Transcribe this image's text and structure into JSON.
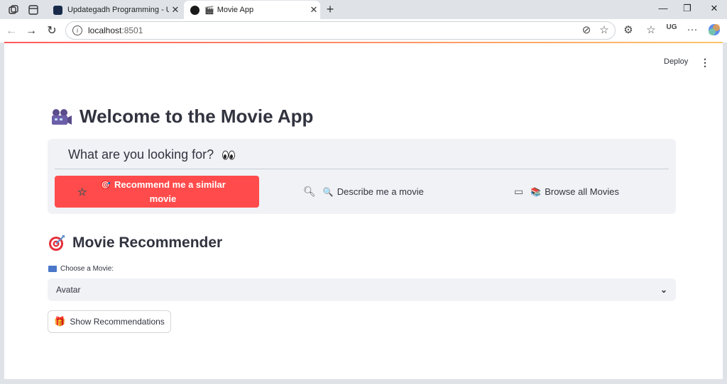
{
  "browser": {
    "tabs": [
      {
        "title": "Updategadh Programming - Upd",
        "active": false,
        "favicon_color": "#1a2b4a"
      },
      {
        "title": "Movie App",
        "active": true,
        "favicon_color": "#1a1a1a"
      }
    ],
    "url_host": "localhost",
    "url_port": ":8501",
    "accent_gradient": [
      "#ff5b5b",
      "#ffc46b"
    ],
    "icons": [
      "workspaces-icon",
      "tab-actions-icon",
      "close-icon",
      "new-tab-icon",
      "minimize-icon",
      "restore-icon",
      "back-icon",
      "forward-icon",
      "refresh-icon",
      "info-icon",
      "tracking-off-icon",
      "favorite-star-icon",
      "extensions-icon",
      "favorites-icon",
      "profile-icon",
      "more-icon",
      "copilot-icon"
    ]
  },
  "app": {
    "deploy_label": "Deploy",
    "title": "Welcome to the Movie App",
    "question": "What are you looking for?",
    "options": [
      {
        "label": "Recommend me a similar movie",
        "emoji": "🎯",
        "icon": "star-icon",
        "selected": true
      },
      {
        "label": "Describe me a movie",
        "emoji": "🔍",
        "icon": "search-icon",
        "selected": false
      },
      {
        "label": "Browse all Movies",
        "emoji": "📚",
        "icon": "box-icon",
        "selected": false
      }
    ],
    "accent_color": "#ff4b4b",
    "section_title": "Movie Recommender",
    "select_label": "Choose a Movie:",
    "selected_movie": "Avatar",
    "button_label": "Show Recommendations"
  }
}
